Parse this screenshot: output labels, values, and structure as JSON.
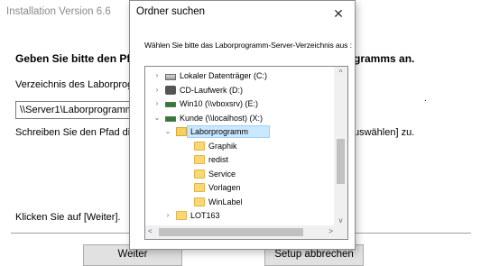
{
  "installer": {
    "title": "Installation Version 6.6",
    "heading_left": "Geben Sie bitte den Pfa",
    "heading_right": "gramms an.",
    "directory_label": "Verzeichnis des Laborprogra",
    "directory_value": "\\\\Server1\\Laborprogramm\\",
    "hint_left": "Schreiben Sie den Pfad dire",
    "hint_right": "uswählen] zu.",
    "dot": ".",
    "click_hint": "Klicken Sie auf [Weiter].",
    "next_label": "Weiter",
    "cancel_label": "Setup abbrechen"
  },
  "dialog": {
    "title": "Ordner suchen",
    "close_glyph": "✕",
    "instruction": "Wählen Sie bitte das Laborprogramm-Server-Verzeichnis aus :",
    "tree": [
      {
        "label": "Lokaler Datenträger (C:)",
        "level": 1,
        "chevron": "›",
        "icon": "drive-icon",
        "selected": false
      },
      {
        "label": "CD-Laufwerk (D:)",
        "level": 1,
        "chevron": "›",
        "icon": "cd-drive-icon",
        "selected": false
      },
      {
        "label": "Win10 (\\\\vboxsrv) (E:)",
        "level": 1,
        "chevron": "›",
        "icon": "network-drive-icon",
        "selected": false
      },
      {
        "label": "Kunde (\\\\localhost) (X:)",
        "level": 1,
        "chevron": "⌄",
        "icon": "network-drive-icon",
        "selected": false
      },
      {
        "label": "Laborprogramm",
        "level": 2,
        "chevron": "⌄",
        "icon": "folder-open-icon",
        "selected": true
      },
      {
        "label": "Graphik",
        "level": 3,
        "chevron": "",
        "icon": "folder-icon",
        "selected": false
      },
      {
        "label": "redist",
        "level": 3,
        "chevron": "",
        "icon": "folder-icon",
        "selected": false
      },
      {
        "label": "Service",
        "level": 3,
        "chevron": "",
        "icon": "folder-icon",
        "selected": false
      },
      {
        "label": "Vorlagen",
        "level": 3,
        "chevron": "",
        "icon": "folder-icon",
        "selected": false
      },
      {
        "label": "WinLabel",
        "level": 3,
        "chevron": "",
        "icon": "folder-icon",
        "selected": false
      },
      {
        "label": "LOT163",
        "level": 2,
        "chevron": "›",
        "icon": "folder-icon",
        "selected": false
      }
    ],
    "scroll_up": "^",
    "scroll_down": "v",
    "scroll_left": "<",
    "scroll_right": ">"
  },
  "colors": {
    "selection_bg": "#cce8ff",
    "selection_border": "#99d1ff",
    "folder": "#f8d775"
  }
}
